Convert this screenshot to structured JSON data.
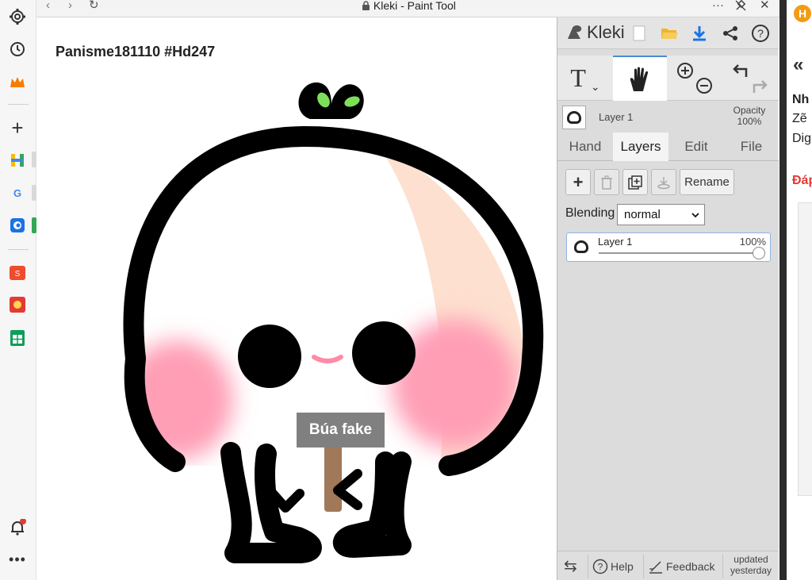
{
  "browser_sidebar": {
    "icons": [
      "settings-icon",
      "history-icon",
      "crown-icon",
      "add-icon",
      "h-app-icon",
      "google-icon",
      "kleki-app-icon",
      "shopee-icon",
      "game-app-icon",
      "sheets-icon",
      "notification-icon",
      "more-icon"
    ]
  },
  "titlebar": {
    "back": "‹",
    "forward": "›",
    "reload": "↻",
    "lock": "🔒",
    "title": "Kleki - Paint Tool",
    "more": "···",
    "pin": "✕",
    "close": "✕"
  },
  "canvas": {
    "label": "Panisme181110 #Hd247",
    "sign_text": "Búa fake",
    "colors": {
      "outline": "#000000",
      "blush": "#ff9eb5",
      "peach": "#fde0cf",
      "leaf": "#7ee05a",
      "stick": "#a0785a",
      "sign_bg": "#808080"
    }
  },
  "panel": {
    "logo": "Kleki",
    "top_icons": [
      "new-file-icon",
      "open-folder-icon",
      "download-icon",
      "share-icon",
      "help-icon"
    ],
    "tools": [
      "text-tool",
      "hand-tool",
      "zoom-tool",
      "undo-redo-tool"
    ],
    "text_tool_glyph": "T",
    "text_tool_chevron": "⌄",
    "layer_name": "Layer 1",
    "opacity_label": "Opacity",
    "opacity_value": "100%",
    "tabs": [
      "Hand",
      "Layers",
      "Edit",
      "File"
    ],
    "active_tab": "Layers",
    "buttons": {
      "add": "+",
      "delete": "🗑",
      "duplicate": "⧉",
      "merge": "⤓",
      "rename": "Rename"
    },
    "blending_label": "Blending",
    "blending_value": "normal",
    "layers": [
      {
        "name": "Layer 1",
        "opacity": "100%",
        "opacity_fraction": 1.0
      }
    ],
    "bottom": {
      "swap": "⇆",
      "help": "Help",
      "feedback": "Feedback",
      "updated_line1": "updated",
      "updated_line2": "yesterday"
    },
    "colors": {
      "accent": "#4a8bd6",
      "download": "#1a73e8",
      "folder": "#f0b429"
    }
  },
  "right_page": {
    "badge": "H",
    "chevrons": "«",
    "lines": [
      "Nh",
      "Zẽ",
      "Dig"
    ],
    "link": "Đáp"
  }
}
